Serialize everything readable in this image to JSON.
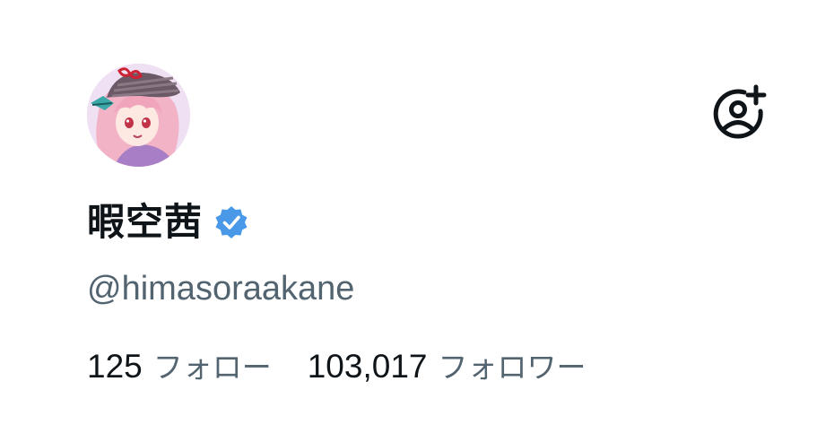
{
  "profile": {
    "display_name": "暇空茜",
    "handle": "@himasoraakane",
    "avatar_icon": "anime-girl-avatar",
    "verified_icon": "verified-badge-icon",
    "verified_color": "#4a99e9"
  },
  "stats": {
    "following_count": "125",
    "following_label": "フォロー",
    "followers_count": "103,017",
    "followers_label": "フォロワー"
  },
  "actions": {
    "follow_icon": "add-user-icon"
  },
  "colors": {
    "text_primary": "#0f1419",
    "text_secondary": "#536471",
    "background": "#ffffff"
  }
}
